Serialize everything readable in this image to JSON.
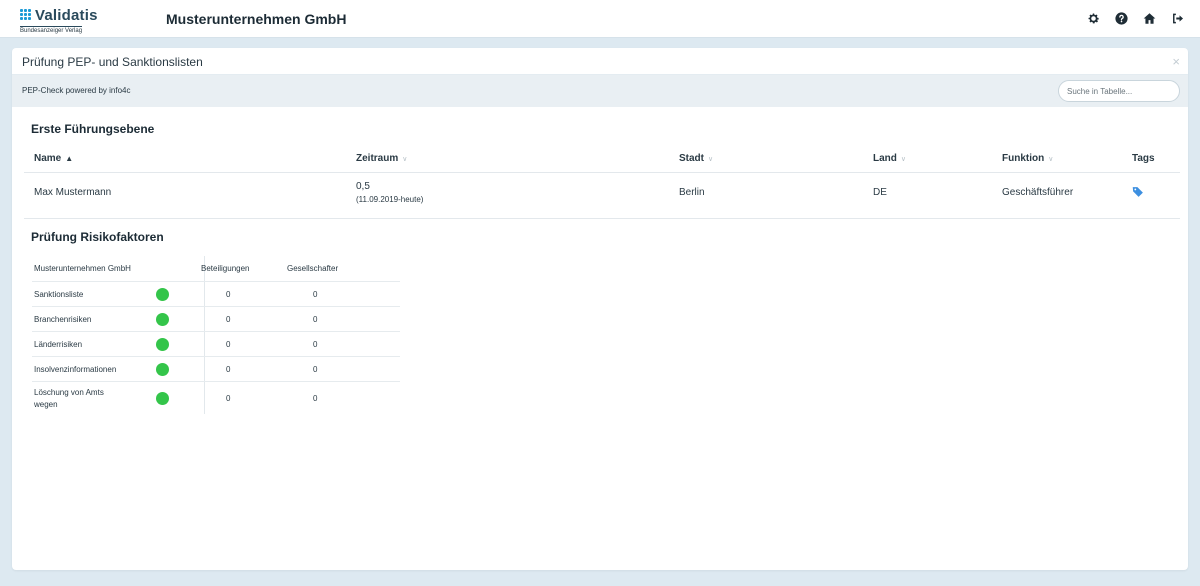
{
  "header": {
    "logo_text": "Validatis",
    "logo_sub": "Bundesanzeiger Verlag",
    "company": "Musterunternehmen GmbH",
    "icons": [
      "gear-icon",
      "help-icon",
      "home-icon",
      "logout-icon"
    ]
  },
  "panel": {
    "title": "Prüfung PEP- und Sanktionslisten",
    "close": "×",
    "powered_by": "PEP-Check powered by info4c",
    "search_placeholder": "Suche in Tabelle..."
  },
  "management": {
    "title": "Erste Führungsebene",
    "columns": [
      "Name",
      "Zeitraum",
      "Stadt",
      "Land",
      "Funktion",
      "Tags"
    ],
    "rows": [
      {
        "name": "Max Mustermann",
        "zeitraum": "0,5",
        "zeitraum_detail": "(11.09.2019-heute)",
        "stadt": "Berlin",
        "land": "DE",
        "funktion": "Geschäftsführer",
        "tag_icon": "tag-icon"
      }
    ]
  },
  "risk": {
    "title": "Prüfung Risikofaktoren",
    "header": {
      "entity": "Musterunternehmen GmbH",
      "col1": "Beteiligungen",
      "col2": "Gesellschafter"
    },
    "status_color": "#34c54a",
    "rows": [
      {
        "label": "Sanktionsliste",
        "beteiligungen": "0",
        "gesellschafter": "0"
      },
      {
        "label": "Branchenrisiken",
        "beteiligungen": "0",
        "gesellschafter": "0"
      },
      {
        "label": "Länderrisiken",
        "beteiligungen": "0",
        "gesellschafter": "0"
      },
      {
        "label": "Insolvenzinformationen",
        "beteiligungen": "0",
        "gesellschafter": "0"
      },
      {
        "label": "Löschung von Amts",
        "label2": "wegen",
        "beteiligungen": "0",
        "gesellschafter": "0"
      }
    ]
  }
}
